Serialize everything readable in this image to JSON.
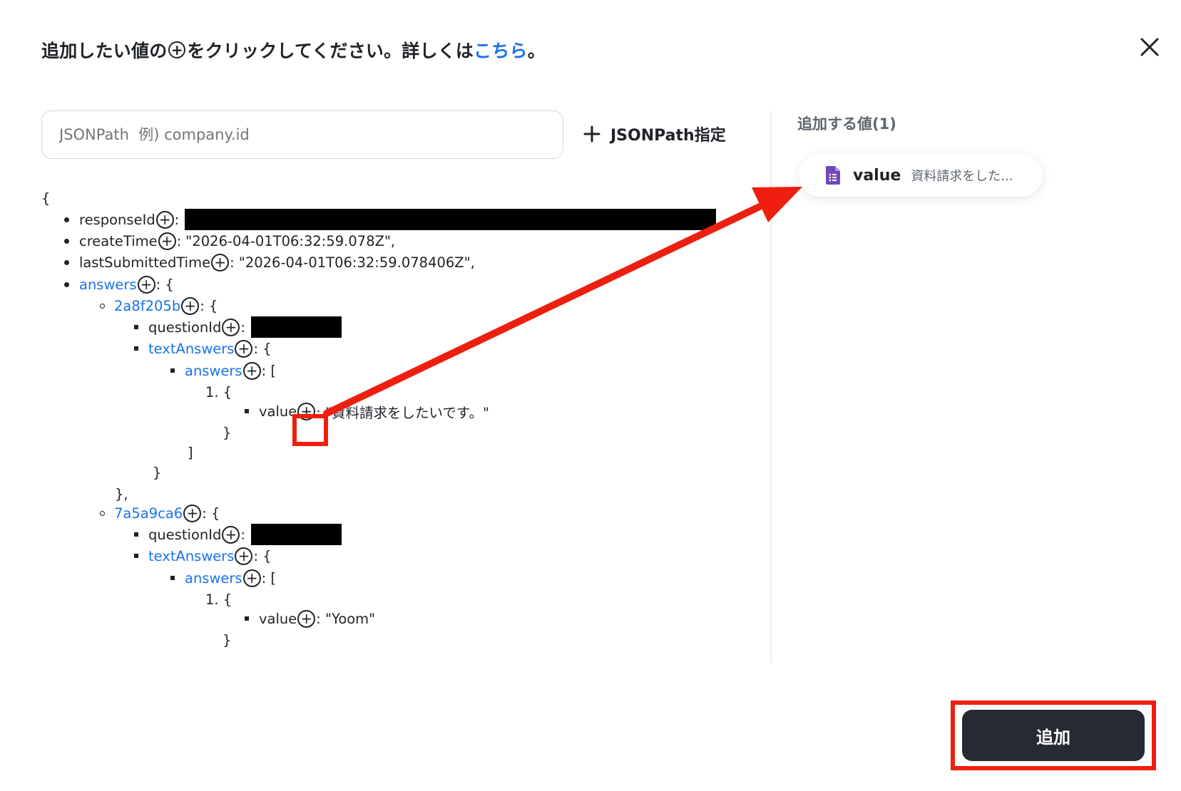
{
  "header": {
    "text_before": "追加したい値の",
    "plus_glyph": "+",
    "text_after": "をクリックしてください。詳しくは",
    "link": "こちら",
    "text_end": "。"
  },
  "search": {
    "placeholder": "JSONPath  例) company.id"
  },
  "jsonpath_button": {
    "icon": "+",
    "label": "JSONPath指定"
  },
  "right_panel": {
    "title": "追加する値(1)",
    "chip": {
      "icon": "google-forms-icon",
      "key": "value",
      "value": "資料請求をした..."
    }
  },
  "tree": {
    "open_brace": "{",
    "responseId_key": "responseId",
    "createTime_key": "createTime",
    "createTime_value": ": \"2026-04-01T06:32:59.078Z\",",
    "lastSubmittedTime_key": "lastSubmittedTime",
    "lastSubmittedTime_value": ": \"2026-04-01T06:32:59.078406Z\",",
    "answers_key": "answers",
    "obj_open": ": {",
    "arr_open": ": [",
    "colon": ":",
    "q1_id": "2a8f205b",
    "q2_id": "7a5a9ca6",
    "questionId_key": "questionId",
    "textAnswers_key": "textAnswers",
    "item_open": "1. {",
    "value_key": "value",
    "value1": ": \"資料請求をしたいです。\"",
    "value2": ": \"Yoom\"",
    "close_brace": "}",
    "close_bracket": "]",
    "close_brace_comma": "},"
  },
  "footer": {
    "add_button": "追加"
  },
  "colors": {
    "accent_link": "#1a73e8",
    "highlight": "#ee1f0e",
    "button_bg": "#262a33"
  }
}
